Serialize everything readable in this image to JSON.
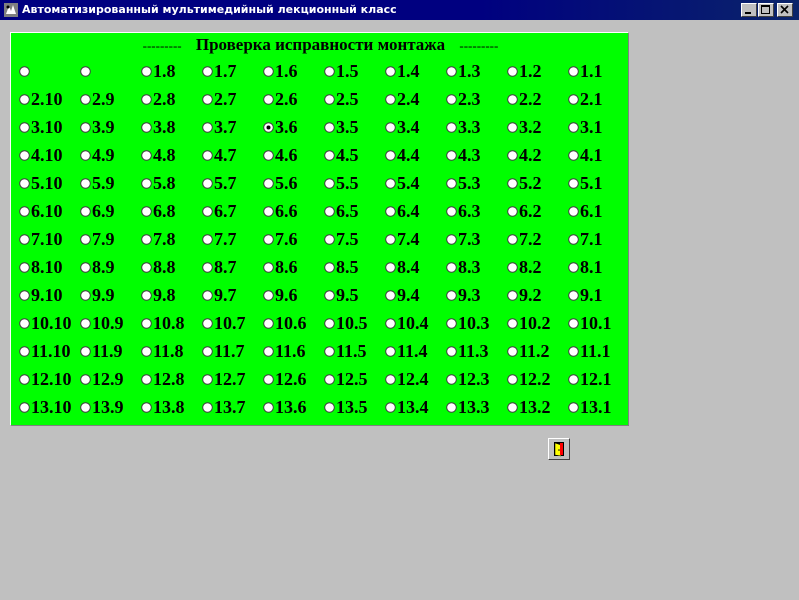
{
  "window": {
    "title": "Автоматизированный мультимедийный лекционный класс"
  },
  "group": {
    "dash_left": "---------",
    "title": "Проверка исправности монтажа",
    "dash_right": "---------"
  },
  "grid": {
    "selected": "3.6",
    "rows": [
      [
        "",
        "",
        "1.8",
        "1.7",
        "1.6",
        "1.5",
        "1.4",
        "1.3",
        "1.2",
        "1.1"
      ],
      [
        "2.10",
        "2.9",
        "2.8",
        "2.7",
        "2.6",
        "2.5",
        "2.4",
        "2.3",
        "2.2",
        "2.1"
      ],
      [
        "3.10",
        "3.9",
        "3.8",
        "3.7",
        "3.6",
        "3.5",
        "3.4",
        "3.3",
        "3.2",
        "3.1"
      ],
      [
        "4.10",
        "4.9",
        "4.8",
        "4.7",
        "4.6",
        "4.5",
        "4.4",
        "4.3",
        "4.2",
        "4.1"
      ],
      [
        "5.10",
        "5.9",
        "5.8",
        "5.7",
        "5.6",
        "5.5",
        "5.4",
        "5.3",
        "5.2",
        "5.1"
      ],
      [
        "6.10",
        "6.9",
        "6.8",
        "6.7",
        "6.6",
        "6.5",
        "6.4",
        "6.3",
        "6.2",
        "6.1"
      ],
      [
        "7.10",
        "7.9",
        "7.8",
        "7.7",
        "7.6",
        "7.5",
        "7.4",
        "7.3",
        "7.2",
        "7.1"
      ],
      [
        "8.10",
        "8.9",
        "8.8",
        "8.7",
        "8.6",
        "8.5",
        "8.4",
        "8.3",
        "8.2",
        "8.1"
      ],
      [
        "9.10",
        "9.9",
        "9.8",
        "9.7",
        "9.6",
        "9.5",
        "9.4",
        "9.3",
        "9.2",
        "9.1"
      ],
      [
        "10.10",
        "10.9",
        "10.8",
        "10.7",
        "10.6",
        "10.5",
        "10.4",
        "10.3",
        "10.2",
        "10.1"
      ],
      [
        "11.10",
        "11.9",
        "11.8",
        "11.7",
        "11.6",
        "11.5",
        "11.4",
        "11.3",
        "11.2",
        "11.1"
      ],
      [
        "12.10",
        "12.9",
        "12.8",
        "12.7",
        "12.6",
        "12.5",
        "12.4",
        "12.3",
        "12.2",
        "12.1"
      ],
      [
        "13.10",
        "13.9",
        "13.8",
        "13.7",
        "13.6",
        "13.5",
        "13.4",
        "13.3",
        "13.2",
        "13.1"
      ]
    ]
  },
  "icons": {
    "app": "app-icon",
    "minimize": "minimize-icon",
    "maximize": "maximize-icon",
    "close": "close-icon",
    "exit": "exit-door-icon"
  },
  "colors": {
    "panel": "#00ff00",
    "titlebar": "#000080",
    "background": "#c0c0c0"
  }
}
